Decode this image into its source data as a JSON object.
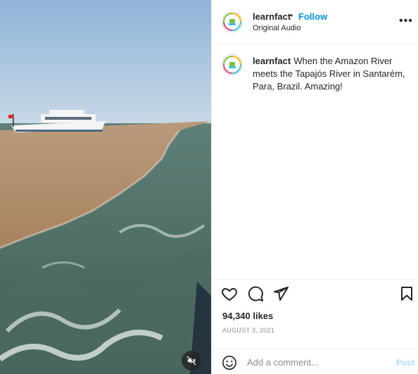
{
  "post": {
    "username": "learnfact",
    "follow_separator": "•",
    "follow_label": "Follow",
    "audio_label": "Original Audio",
    "more_label": "•••",
    "caption_text": "When the Amazon River meets the Tapajós River in Santarém, Para, Brazil. Amazing!",
    "likes": "94,340 likes",
    "date": "AUGUST 3, 2021"
  },
  "comment": {
    "placeholder": "Add a comment...",
    "post_label": "Post"
  },
  "icons": {
    "like": "heart-icon",
    "comment": "comment-icon",
    "share": "send-icon",
    "save": "bookmark-icon",
    "mute": "speaker-muted-icon",
    "emoji": "emoji-icon"
  },
  "colors": {
    "accent": "#0095f6",
    "post_disabled": "#b2dffc",
    "secondary_text": "#8e8e8e"
  }
}
